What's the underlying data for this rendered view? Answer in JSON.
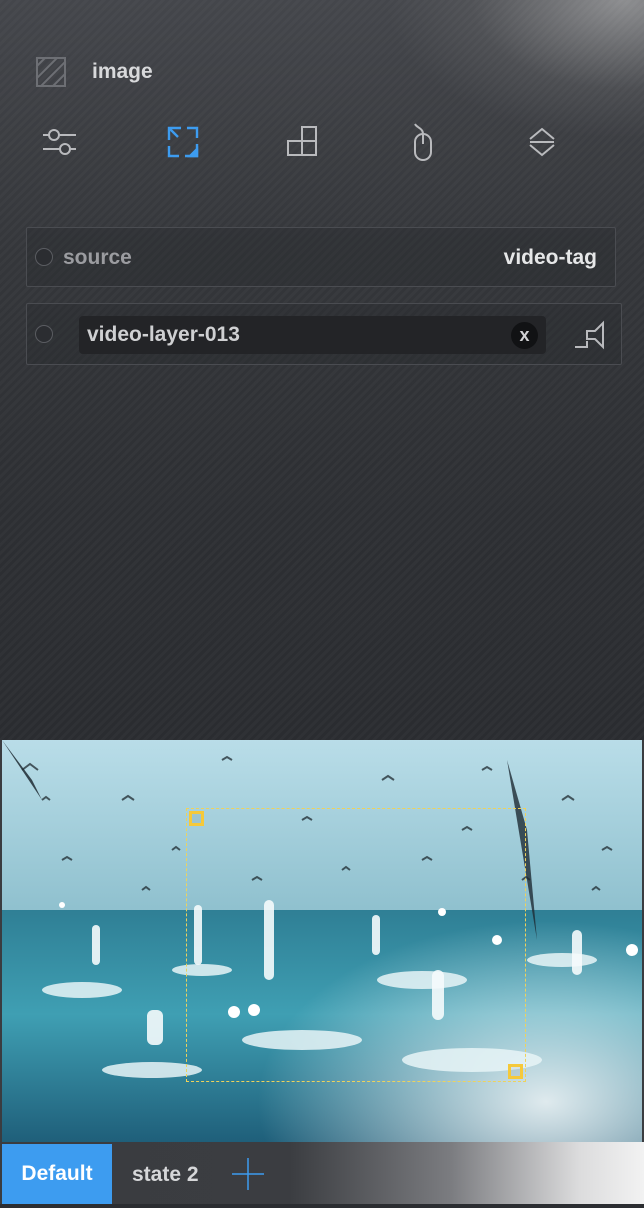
{
  "header": {
    "title": "image",
    "type_icon": "hatched-square-icon"
  },
  "toolbar": {
    "tools": [
      {
        "name": "sliders-icon",
        "active": false
      },
      {
        "name": "resize-frame-icon",
        "active": true
      },
      {
        "name": "layout-blocks-icon",
        "active": false
      },
      {
        "name": "mouse-icon",
        "active": false
      },
      {
        "name": "expand-collapse-icon",
        "active": false
      }
    ],
    "accent": "#3d9cf0"
  },
  "source": {
    "label": "source",
    "value": "video-tag"
  },
  "layer": {
    "name": "video-layer-013",
    "clear_label": "x",
    "audio_icon": "speaker-icon"
  },
  "preview": {
    "description_icon": "video-preview"
  },
  "tabs": {
    "active": "Default",
    "second": "state 2",
    "add_icon": "plus-icon"
  },
  "colors": {
    "selection": "#f5c93a",
    "panel": "#2d2f33"
  }
}
